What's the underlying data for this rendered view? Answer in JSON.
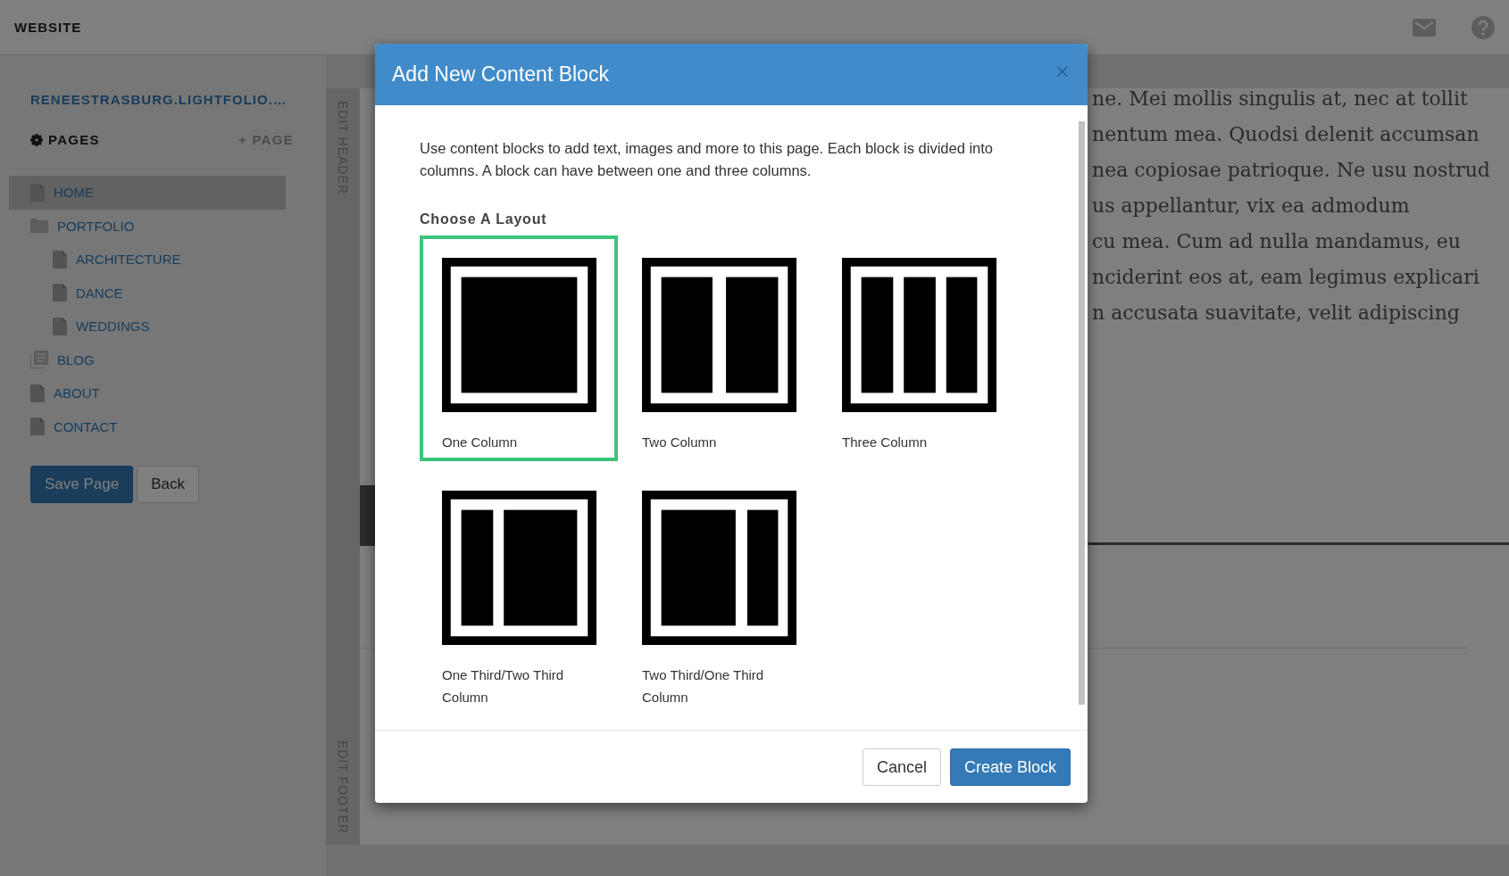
{
  "topbar": {
    "title": "WEBSITE"
  },
  "sidebar": {
    "site_name": "RENEESTRASBURG.LIGHTFOLIO.…",
    "pages_heading": "PAGES",
    "add_page": "+ PAGE",
    "items": [
      {
        "label": "HOME",
        "kind": "page",
        "selected": true
      },
      {
        "label": "PORTFOLIO",
        "kind": "folder",
        "selected": false,
        "children": [
          {
            "label": "ARCHITECTURE",
            "kind": "page",
            "selected": false
          },
          {
            "label": "DANCE",
            "kind": "page",
            "selected": false
          },
          {
            "label": "WEDDINGS",
            "kind": "page",
            "selected": false
          }
        ]
      },
      {
        "label": "BLOG",
        "kind": "blog",
        "selected": false
      },
      {
        "label": "ABOUT",
        "kind": "page",
        "selected": false
      },
      {
        "label": "CONTACT",
        "kind": "page",
        "selected": false
      }
    ],
    "buttons": [
      "Save Page",
      "Back"
    ]
  },
  "editor": {
    "header_tab": "EDIT HEADER",
    "footer_tab": "EDIT FOOTER",
    "text_lines": [
      "ne. Mei mollis singulis at, nec at tollit",
      "nentum mea. Quodsi delenit accumsan",
      "nea copiosae patrioque. Ne usu nostrud",
      "us appellantur, vix ea admodum",
      "cu mea. Cum ad nulla mandamus, eu",
      "nciderint eos at, eam legimus explicari",
      "n accusata suavitate, velit adipiscing"
    ]
  },
  "modal": {
    "title": "Add New Content Block",
    "close": "×",
    "description": "Use content blocks to add text, images and more to this page. Each block is divided into columns. A block can have between one and three columns.",
    "layout_heading": "Choose A Layout",
    "layouts": [
      {
        "label": "One Column",
        "kind": "one",
        "selected": true
      },
      {
        "label": "Two Column",
        "kind": "two",
        "selected": false
      },
      {
        "label": "Three Column",
        "kind": "three",
        "selected": false
      },
      {
        "label": "One Third/Two Third Column",
        "kind": "narrowwide",
        "selected": false
      },
      {
        "label": "Two Third/One Third Column",
        "kind": "widenarrow",
        "selected": false
      }
    ],
    "buttons": [
      "Cancel",
      "Create Block"
    ]
  }
}
